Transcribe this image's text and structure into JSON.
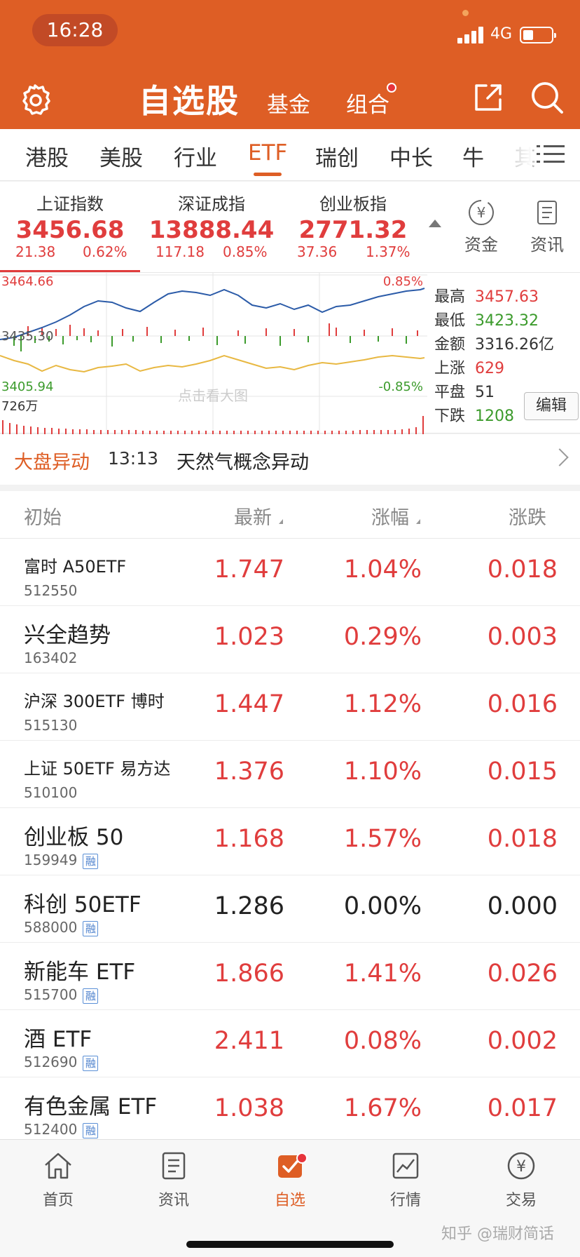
{
  "status_bar": {
    "time": "16:28",
    "network": "4G"
  },
  "header": {
    "title": "自选股",
    "tab_fund": "基金",
    "tab_combo": "组合"
  },
  "category_tabs": [
    "港股",
    "美股",
    "行业",
    "ETF",
    "瑞创",
    "中长",
    "牛",
    "其"
  ],
  "active_category": "ETF",
  "indices": [
    {
      "name": "上证指数",
      "value": "3456.68",
      "change": "21.38",
      "percent": "0.62%"
    },
    {
      "name": "深证成指",
      "value": "13888.44",
      "change": "117.18",
      "percent": "0.85%"
    },
    {
      "name": "创业板指",
      "value": "2771.32",
      "change": "37.36",
      "percent": "1.37%"
    }
  ],
  "side_buttons": {
    "funds": "资金",
    "news": "资讯"
  },
  "chart": {
    "y_high": "3464.66",
    "y_mid": "3435.30",
    "y_low": "3405.94",
    "pct_high": "0.85%",
    "pct_low": "-0.85%",
    "volume": "726万",
    "hint": "点击看大图"
  },
  "stats": [
    {
      "label": "最高",
      "value": "3457.63",
      "color": "red"
    },
    {
      "label": "最低",
      "value": "3423.32",
      "color": "green"
    },
    {
      "label": "金额",
      "value": "3316.26亿",
      "color": "normal"
    },
    {
      "label": "上涨",
      "value": "629",
      "color": "red"
    },
    {
      "label": "平盘",
      "value": "51",
      "color": "normal"
    },
    {
      "label": "下跌",
      "value": "1208",
      "color": "green"
    }
  ],
  "edit_label": "编辑",
  "alert": {
    "tag": "大盘异动",
    "time": "13:13",
    "text": "天然气概念异动"
  },
  "table": {
    "headers": {
      "name": "初始",
      "price": "最新",
      "change_pct": "涨幅",
      "change": "涨跌"
    },
    "rows": [
      {
        "name": "富时 A50ETF",
        "code": "512550",
        "rong": false,
        "price": "1.747",
        "pct": "1.04%",
        "chg": "0.018",
        "trend": "up"
      },
      {
        "name": "兴全趋势",
        "code": "163402",
        "rong": false,
        "price": "1.023",
        "pct": "0.29%",
        "chg": "0.003",
        "trend": "up"
      },
      {
        "name": "沪深 300ETF 博时",
        "code": "515130",
        "rong": false,
        "price": "1.447",
        "pct": "1.12%",
        "chg": "0.016",
        "trend": "up"
      },
      {
        "name": "上证 50ETF 易方达",
        "code": "510100",
        "rong": false,
        "price": "1.376",
        "pct": "1.10%",
        "chg": "0.015",
        "trend": "up"
      },
      {
        "name": "创业板 50",
        "code": "159949",
        "rong": true,
        "price": "1.168",
        "pct": "1.57%",
        "chg": "0.018",
        "trend": "up"
      },
      {
        "name": "科创 50ETF",
        "code": "588000",
        "rong": true,
        "price": "1.286",
        "pct": "0.00%",
        "chg": "0.000",
        "trend": "flat"
      },
      {
        "name": "新能车 ETF",
        "code": "515700",
        "rong": true,
        "price": "1.866",
        "pct": "1.41%",
        "chg": "0.026",
        "trend": "up"
      },
      {
        "name": "酒 ETF",
        "code": "512690",
        "rong": true,
        "price": "2.411",
        "pct": "0.08%",
        "chg": "0.002",
        "trend": "up"
      },
      {
        "name": "有色金属 ETF",
        "code": "512400",
        "rong": true,
        "price": "1.038",
        "pct": "1.67%",
        "chg": "0.017",
        "trend": "up"
      }
    ]
  },
  "rong_label": "融",
  "bottom_nav": [
    {
      "label": "首页",
      "icon": "home-icon"
    },
    {
      "label": "资讯",
      "icon": "news-icon"
    },
    {
      "label": "自选",
      "icon": "watchlist-icon"
    },
    {
      "label": "行情",
      "icon": "chart-icon"
    },
    {
      "label": "交易",
      "icon": "yuan-icon"
    }
  ],
  "watermark": "知乎 @瑞财简话",
  "colors": {
    "brand": "#de5e25",
    "up": "#e03d3d",
    "down": "#3c9b2c"
  }
}
